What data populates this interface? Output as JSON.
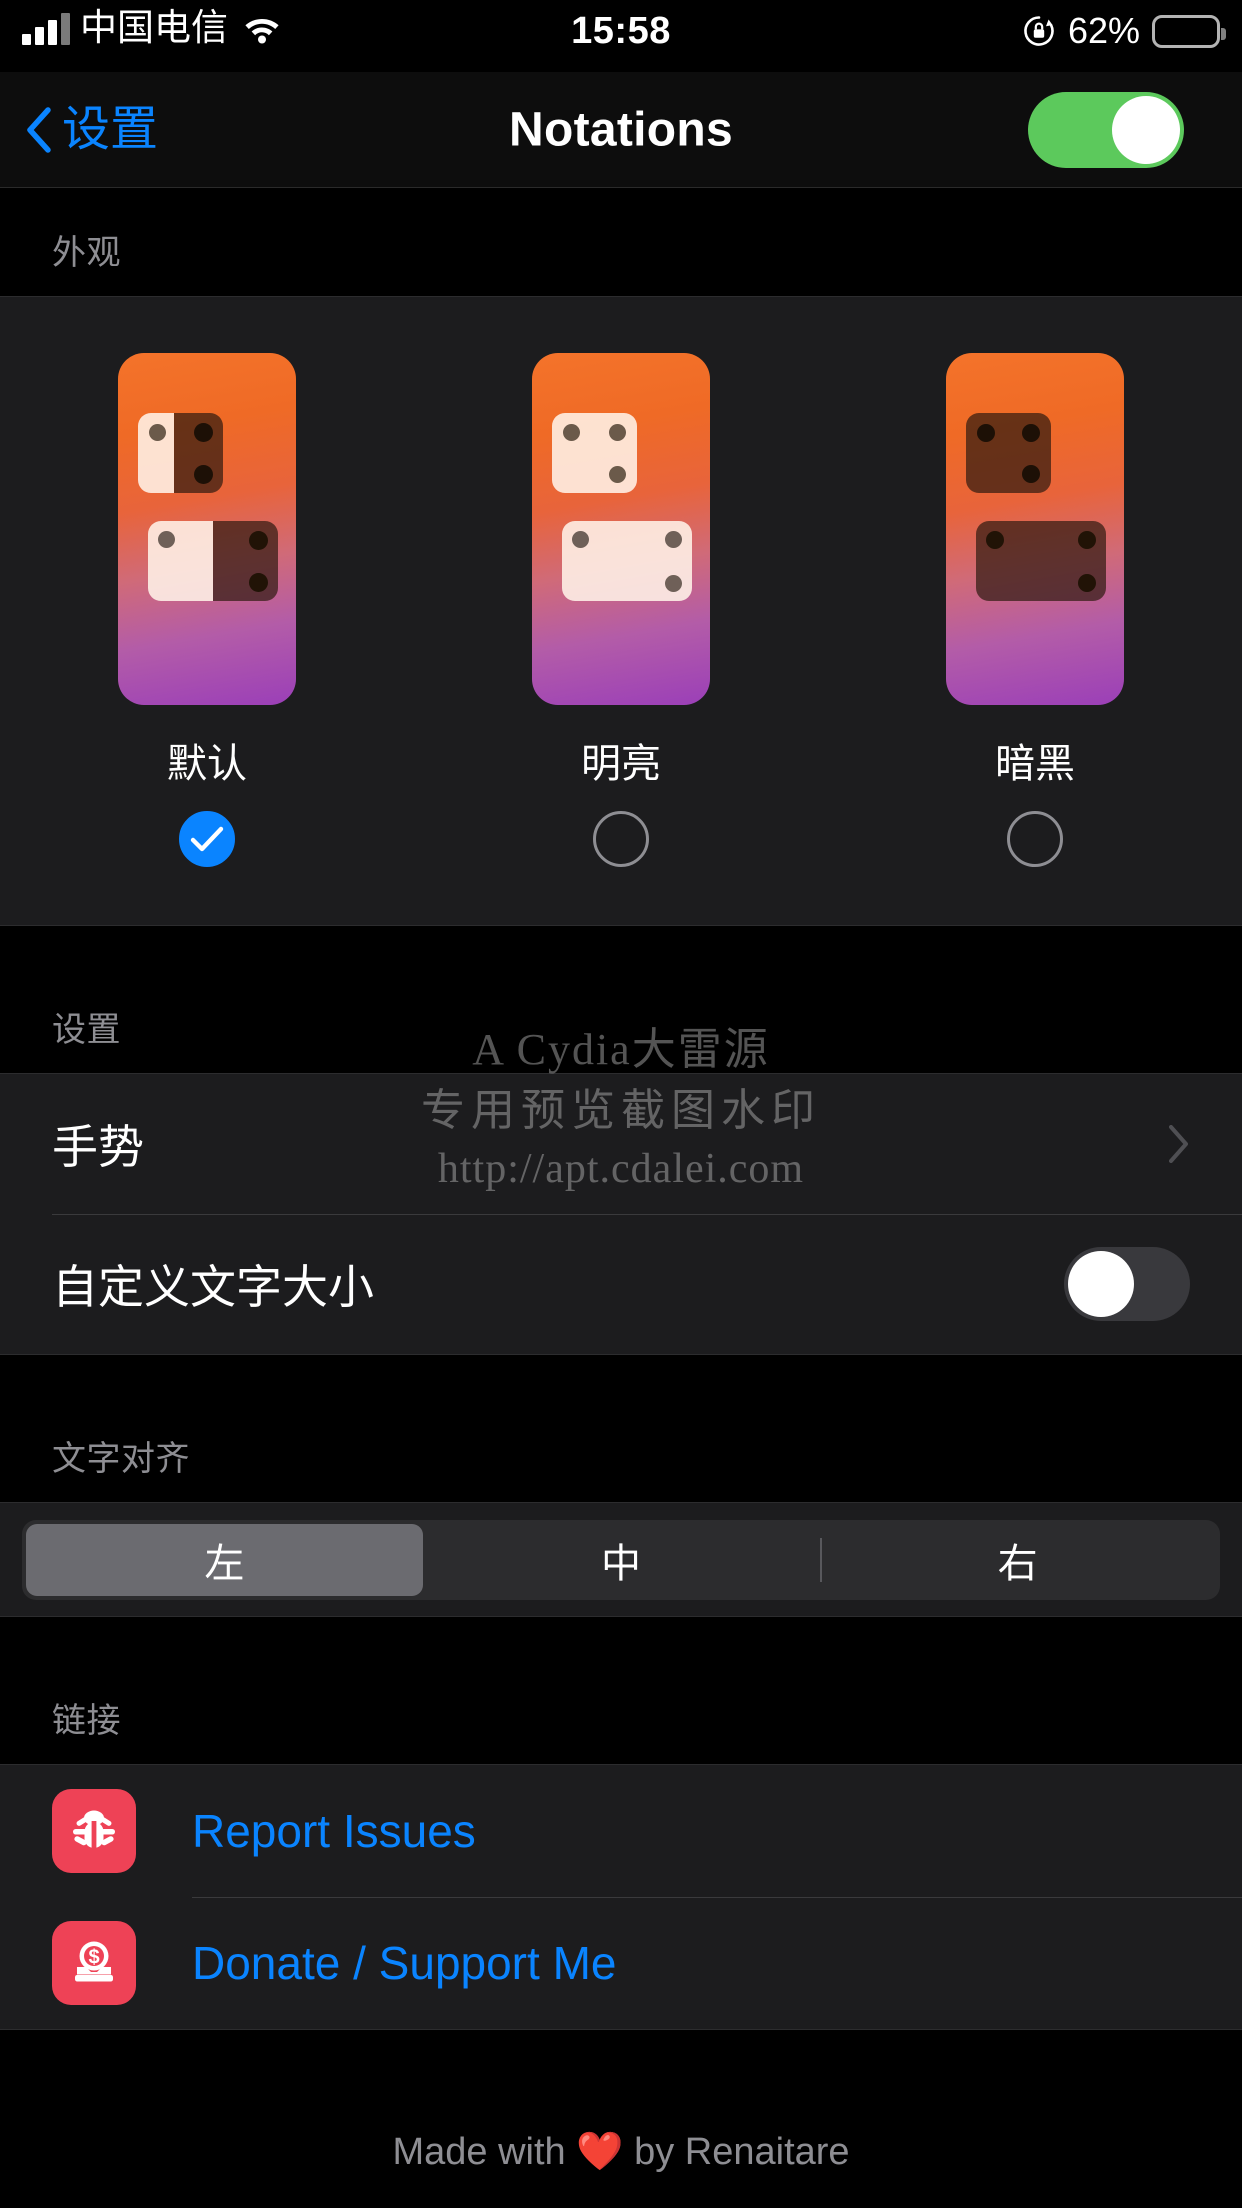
{
  "status_bar": {
    "carrier": "中国电信",
    "time": "15:58",
    "battery_percent": "62%",
    "battery_level": 62,
    "signal_icon": "cellular-signal-icon",
    "wifi_icon": "wifi-icon",
    "rotation_lock_icon": "rotation-lock-icon",
    "battery_icon": "battery-icon"
  },
  "nav_bar": {
    "back_label": "设置",
    "back_icon": "chevron-left-icon",
    "title": "Notations",
    "master_switch": {
      "on": true,
      "color_on": "#5cc95c"
    }
  },
  "appearance": {
    "section_title": "外观",
    "themes": [
      {
        "label": "默认",
        "selected": true,
        "top_card": "split",
        "bottom_card": "split"
      },
      {
        "label": "明亮",
        "selected": false,
        "top_card": "light",
        "bottom_card": "light"
      },
      {
        "label": "暗黑",
        "selected": false,
        "top_card": "dark",
        "bottom_card": "dark"
      }
    ],
    "selected_color": "#0a84ff"
  },
  "settings": {
    "section_title": "设置",
    "rows": [
      {
        "label": "手势",
        "type": "disclosure",
        "accessory": "chevron-right-icon"
      },
      {
        "label": "自定义文字大小",
        "type": "switch",
        "on": false
      }
    ]
  },
  "text_align": {
    "section_title": "文字对齐",
    "options": [
      "左",
      "中",
      "右"
    ],
    "selected_index": 0
  },
  "links": {
    "section_title": "链接",
    "rows": [
      {
        "label": "Report Issues",
        "icon": "bug-icon",
        "icon_bg": "#ee4256"
      },
      {
        "label": "Donate / Support Me",
        "icon": "donate-coin-icon",
        "icon_bg": "#ee4256"
      }
    ],
    "link_color": "#0a84ff"
  },
  "footer": {
    "prefix": "Made with ",
    "heart": "❤️",
    "suffix": " by Renaitare"
  },
  "watermark": {
    "line1": "A Cydia大雷源",
    "line2": "专用预览截图水印",
    "line3": "http://apt.cdalei.com"
  }
}
